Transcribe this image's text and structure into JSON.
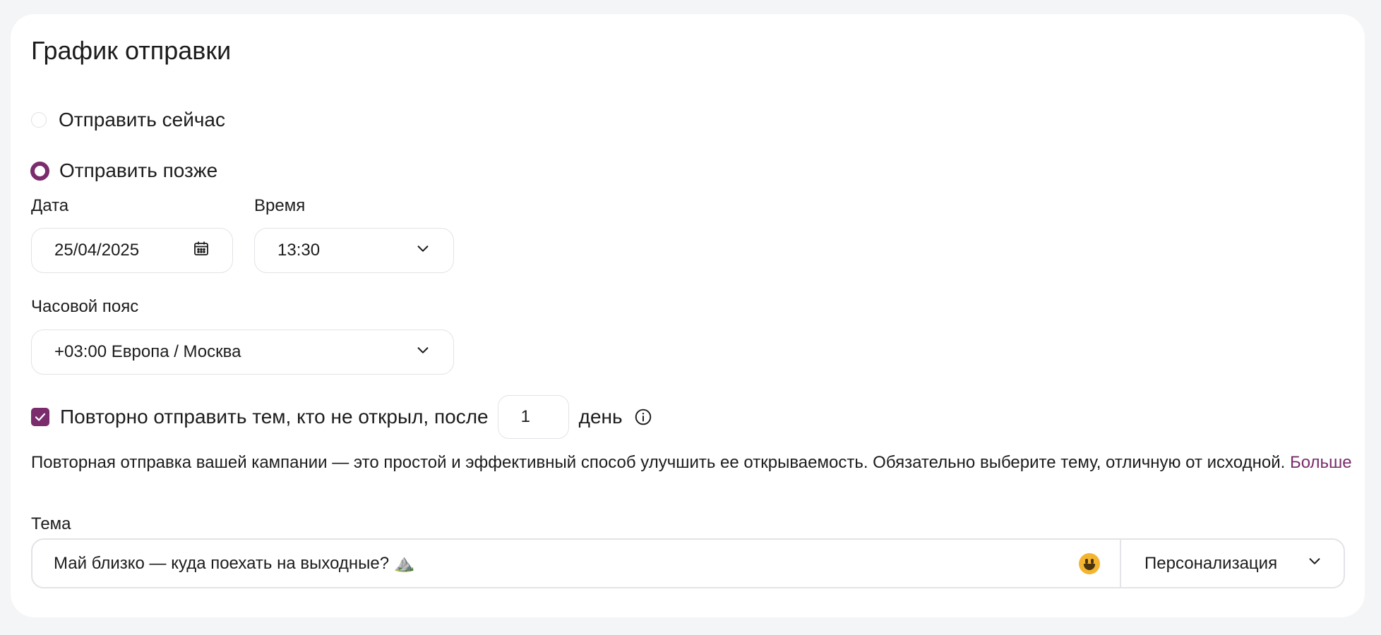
{
  "schedule": {
    "title": "График отправки",
    "option_now": "Отправить сейчас",
    "option_later": "Отправить позже",
    "selected": "later"
  },
  "date": {
    "label": "Дата",
    "value": "25/04/2025"
  },
  "time": {
    "label": "Время",
    "value": "13:30"
  },
  "timezone": {
    "label": "Часовой пояс",
    "value": "+03:00 Европа / Москва"
  },
  "resend": {
    "checked": true,
    "label": "Повторно отправить тем, кто не открыл, после",
    "days_value": "1",
    "unit": "день"
  },
  "description": {
    "text": "Повторная отправка вашей кампании — это простой и эффективный способ улучшить ее открываемость. Обязательно выберите тему, отличную от исходной.",
    "link": "Больше"
  },
  "subject": {
    "label": "Тема",
    "value": "Май близко — куда поехать на выходные? ⛰️",
    "personalization": "Персонализация"
  },
  "colors": {
    "accent": "#7a2c6c",
    "border": "#e3e3e8",
    "background": "#f4f5f7"
  },
  "icons": {
    "date": "calendar-icon",
    "dropdown": "chevron-down-icon",
    "info": "info-icon",
    "emoji": "smiley-emoji-icon",
    "check": "checkmark-icon"
  }
}
